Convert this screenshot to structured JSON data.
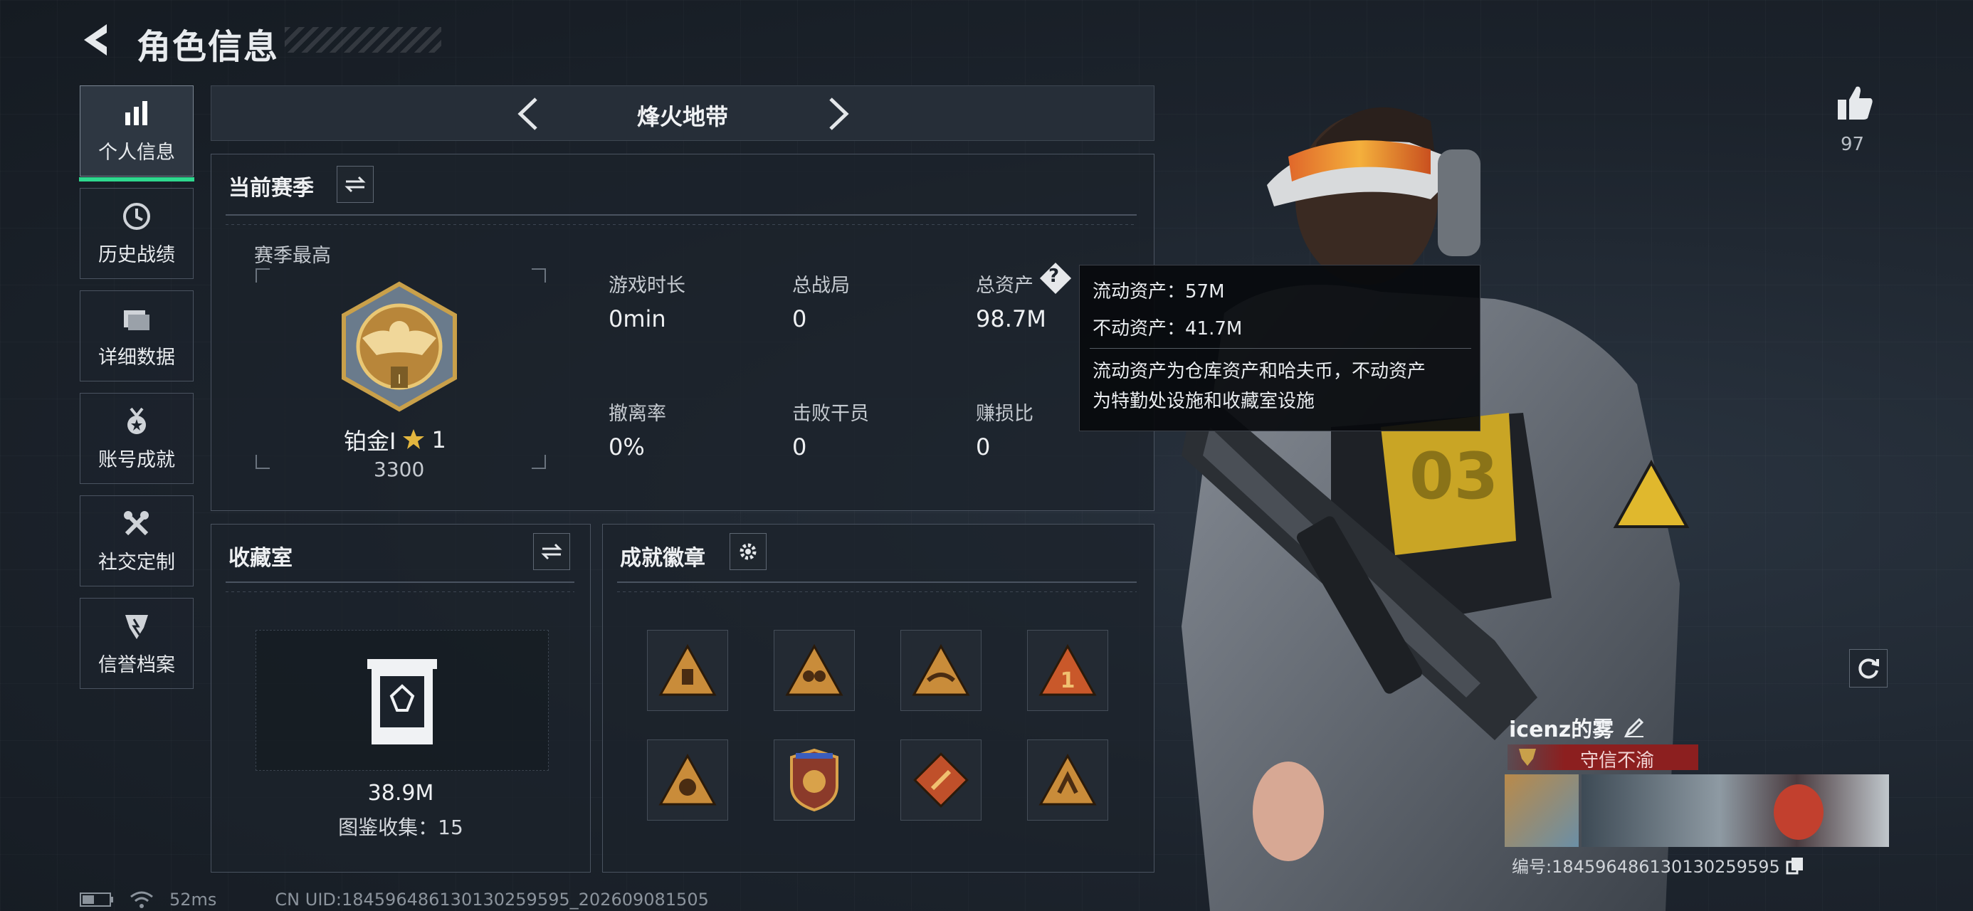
{
  "header": {
    "title": "角色信息",
    "back_icon": "back-arrow-icon"
  },
  "sidebar": {
    "items": [
      {
        "label": "个人信息",
        "icon": "bar-chart-icon",
        "active": true
      },
      {
        "label": "历史战绩",
        "icon": "clock-icon"
      },
      {
        "label": "详细数据",
        "icon": "folder-icon"
      },
      {
        "label": "账号成就",
        "icon": "medal-icon"
      },
      {
        "label": "社交定制",
        "icon": "tools-icon"
      },
      {
        "label": "信誉档案",
        "icon": "shield-icon"
      }
    ]
  },
  "mode_bar": {
    "label": "烽火地带"
  },
  "season": {
    "title": "当前赛季",
    "best_label": "赛季最高",
    "rank_name": "铂金Ⅰ",
    "rank_stars": "1",
    "rank_score": "3300",
    "stats": [
      {
        "label": "游戏时长",
        "value": "0min"
      },
      {
        "label": "总战局",
        "value": "0"
      },
      {
        "label": "总资产",
        "value": "98.7M"
      },
      {
        "label": "撤离率",
        "value": "0%"
      },
      {
        "label": "击败干员",
        "value": "0"
      },
      {
        "label": "赚损比",
        "value": "0"
      }
    ]
  },
  "tooltip": {
    "liquid": "流动资产：57M",
    "fixed": "不动资产：41.7M",
    "desc_line1": "流动资产为仓库资产和哈夫币，不动资产",
    "desc_line2": "为特勤处设施和收藏室设施"
  },
  "collection": {
    "title": "收藏室",
    "value": "38.9M",
    "catalog": "图鉴收集：15"
  },
  "achievements": {
    "title": "成就徽章",
    "badges": [
      "badge-1",
      "badge-2",
      "badge-3",
      "badge-4",
      "badge-5",
      "badge-6",
      "badge-7",
      "badge-8"
    ]
  },
  "like": {
    "count": "97"
  },
  "player": {
    "name": "icenz的雾",
    "title_badge": "守信不渝",
    "id_text": "编号:1845964861301302595​95"
  },
  "status_bar": {
    "ping": "52ms",
    "uid": "CN UID:1845964861301302595​95_202609081505"
  },
  "colors": {
    "accent": "#2ed88e",
    "gold": "#c9a04a",
    "danger": "#8c1f1f"
  }
}
